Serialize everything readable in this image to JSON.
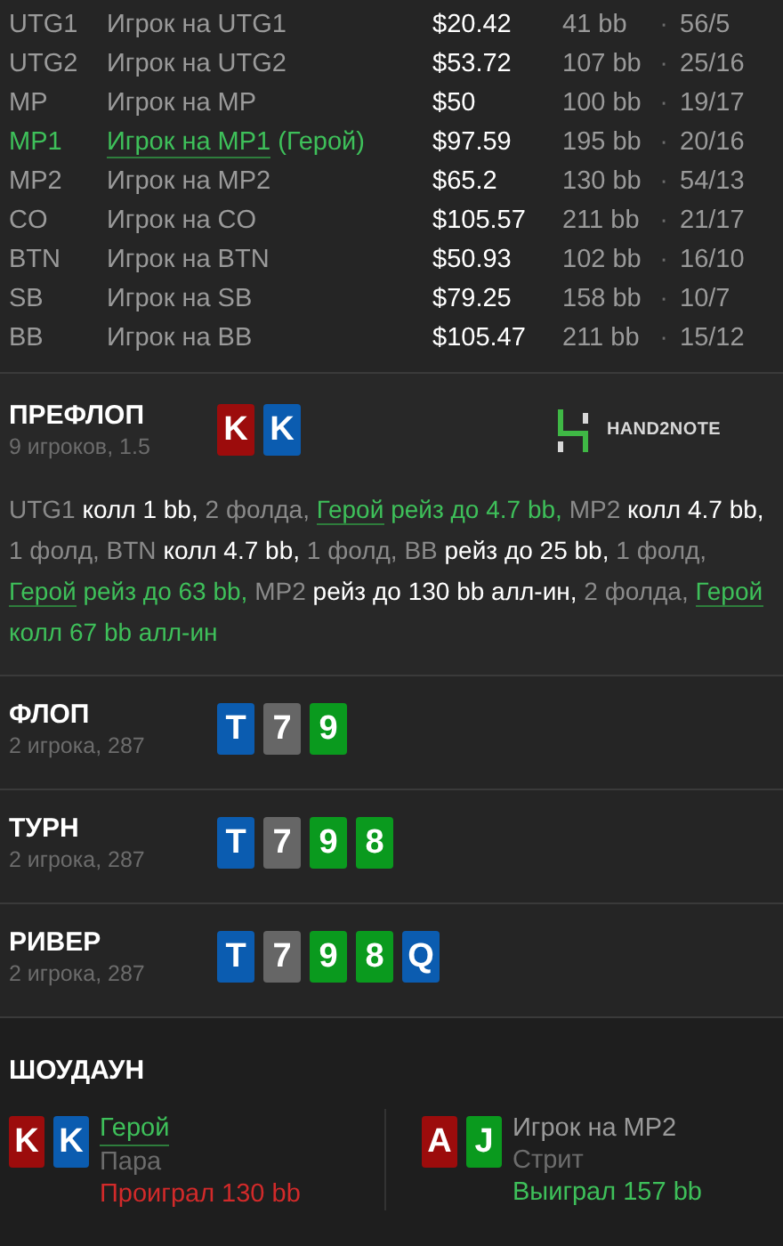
{
  "players": [
    {
      "position": "UTG1",
      "name": "Игрок на UTG1",
      "hero": false,
      "stack": "$20.42",
      "bb": "41 bb",
      "sep": "·",
      "stats": "56/5"
    },
    {
      "position": "UTG2",
      "name": "Игрок на UTG2",
      "hero": false,
      "stack": "$53.72",
      "bb": "107 bb",
      "sep": "·",
      "stats": "25/16"
    },
    {
      "position": "MP",
      "name": "Игрок на MP",
      "hero": false,
      "stack": "$50",
      "bb": "100 bb",
      "sep": "·",
      "stats": "19/17"
    },
    {
      "position": "MP1",
      "name": "Игрок на MP1",
      "hero": true,
      "hero_label": "(Герой)",
      "stack": "$97.59",
      "bb": "195 bb",
      "sep": "·",
      "stats": "20/16"
    },
    {
      "position": "MP2",
      "name": "Игрок на MP2",
      "hero": false,
      "stack": "$65.2",
      "bb": "130 bb",
      "sep": "·",
      "stats": "54/13"
    },
    {
      "position": "CO",
      "name": "Игрок на CO",
      "hero": false,
      "stack": "$105.57",
      "bb": "211 bb",
      "sep": "·",
      "stats": "21/17"
    },
    {
      "position": "BTN",
      "name": "Игрок на BTN",
      "hero": false,
      "stack": "$50.93",
      "bb": "102 bb",
      "sep": "·",
      "stats": "16/10"
    },
    {
      "position": "SB",
      "name": "Игрок на SB",
      "hero": false,
      "stack": "$79.25",
      "bb": "158 bb",
      "sep": "·",
      "stats": "10/7"
    },
    {
      "position": "BB",
      "name": "Игрок на BB",
      "hero": false,
      "stack": "$105.47",
      "bb": "211 bb",
      "sep": "·",
      "stats": "15/12"
    }
  ],
  "preflop": {
    "title": "ПРЕФЛОП",
    "info": "9 игроков, 1.5",
    "cards": [
      {
        "rank": "K",
        "color": "#9c0c0c"
      },
      {
        "rank": "K",
        "color": "#0b5cb0"
      }
    ],
    "logo": "HAND2NOTE",
    "actions": [
      {
        "text": "UTG1",
        "kind": "player"
      },
      {
        "text": "колл 1 bb,",
        "kind": "action"
      },
      {
        "text": "2 фолда,",
        "kind": "muted"
      },
      {
        "text": "Герой",
        "kind": "hero"
      },
      {
        "text": "рейз до 4.7 bb,",
        "kind": "hero_action"
      },
      {
        "text": "MP2",
        "kind": "player"
      },
      {
        "text": "колл 4.7 bb,",
        "kind": "action"
      },
      {
        "text": "1 фолд,",
        "kind": "muted"
      },
      {
        "text": "BTN",
        "kind": "player"
      },
      {
        "text": "колл 4.7 bb,",
        "kind": "action"
      },
      {
        "text": "1 фолд,",
        "kind": "muted"
      },
      {
        "text": "BB",
        "kind": "player"
      },
      {
        "text": "рейз до 25 bb,",
        "kind": "action"
      },
      {
        "text": "1 фолд,",
        "kind": "muted"
      },
      {
        "text": "Герой",
        "kind": "hero"
      },
      {
        "text": "рейз до 63 bb,",
        "kind": "hero_action"
      },
      {
        "text": "MP2",
        "kind": "player"
      },
      {
        "text": "рейз до 130 bb алл-ин,",
        "kind": "action"
      },
      {
        "text": "2 фолда,",
        "kind": "muted"
      },
      {
        "text": "Герой",
        "kind": "hero"
      },
      {
        "text": "колл 67 bb алл-ин",
        "kind": "hero_action"
      }
    ]
  },
  "streets": [
    {
      "title": "ФЛОП",
      "info": "2 игрока, 287",
      "cards": [
        {
          "rank": "T",
          "color": "#0b5cb0"
        },
        {
          "rank": "7",
          "color": "#666666"
        },
        {
          "rank": "9",
          "color": "#0a9a1e"
        }
      ]
    },
    {
      "title": "ТУРН",
      "info": "2 игрока, 287",
      "cards": [
        {
          "rank": "T",
          "color": "#0b5cb0"
        },
        {
          "rank": "7",
          "color": "#666666"
        },
        {
          "rank": "9",
          "color": "#0a9a1e"
        },
        {
          "rank": "8",
          "color": "#0a9a1e"
        }
      ]
    },
    {
      "title": "РИВЕР",
      "info": "2 игрока, 287",
      "cards": [
        {
          "rank": "T",
          "color": "#0b5cb0"
        },
        {
          "rank": "7",
          "color": "#666666"
        },
        {
          "rank": "9",
          "color": "#0a9a1e"
        },
        {
          "rank": "8",
          "color": "#0a9a1e"
        },
        {
          "rank": "Q",
          "color": "#0b5cb0"
        }
      ]
    }
  ],
  "showdown": {
    "title": "ШОУДАУН",
    "hands": [
      {
        "cards": [
          {
            "rank": "K",
            "color": "#9c0c0c"
          },
          {
            "rank": "K",
            "color": "#0b5cb0"
          }
        ],
        "name": "Герой",
        "hero": true,
        "hand": "Пара",
        "result": "Проиграл 130 bb",
        "kind": "lost"
      },
      {
        "cards": [
          {
            "rank": "A",
            "color": "#9c0c0c"
          },
          {
            "rank": "J",
            "color": "#0a9a1e"
          }
        ],
        "name": "Игрок на MP2",
        "hero": false,
        "hand": "Стрит",
        "result": "Выиграл 157 bb",
        "kind": "won"
      }
    ]
  }
}
